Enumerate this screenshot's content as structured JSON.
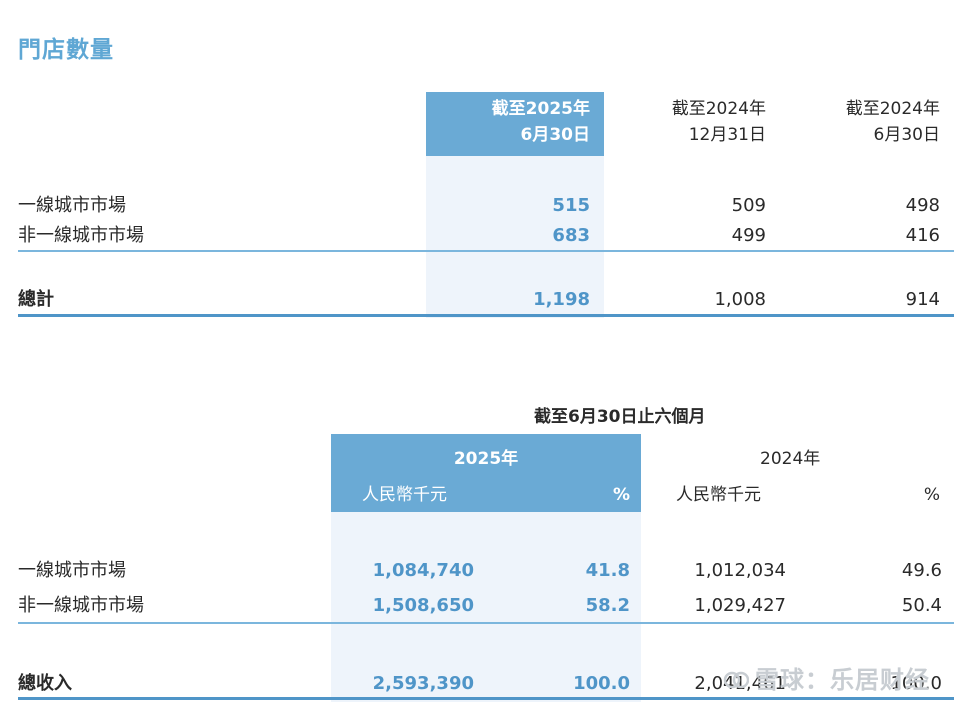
{
  "title": "門店數量",
  "table1": {
    "headers": {
      "col1": [
        "截至2025年",
        "6月30日"
      ],
      "col2": [
        "截至2024年",
        "12月31日"
      ],
      "col3": [
        "截至2024年",
        "6月30日"
      ]
    },
    "rows": [
      {
        "label": "一線城市市場",
        "v1": "515",
        "v2": "509",
        "v3": "498"
      },
      {
        "label": "非一線城市市場",
        "v1": "683",
        "v2": "499",
        "v3": "416"
      }
    ],
    "total": {
      "label": "總計",
      "v1": "1,198",
      "v2": "1,008",
      "v3": "914"
    }
  },
  "table2": {
    "period": "截至6月30日止六個月",
    "year_2025": "2025年",
    "year_2024": "2024年",
    "unit_rmb": "人民幣千元",
    "unit_pct": "%",
    "rows": [
      {
        "label": "一線城市市場",
        "a": "1,084,740",
        "ap": "41.8",
        "b": "1,012,034",
        "bp": "49.6"
      },
      {
        "label": "非一線城市市場",
        "a": "1,508,650",
        "ap": "58.2",
        "b": "1,029,427",
        "bp": "50.4"
      }
    ],
    "total": {
      "label": "總收入",
      "a": "2,593,390",
      "ap": "100.0",
      "b": "2,041,461",
      "bp": "100.0"
    }
  },
  "watermark": "雪球：乐居财经",
  "colors": {
    "accent": "#5fa7d4",
    "band": "#6aaad5",
    "band_light": "#eef4fb"
  }
}
